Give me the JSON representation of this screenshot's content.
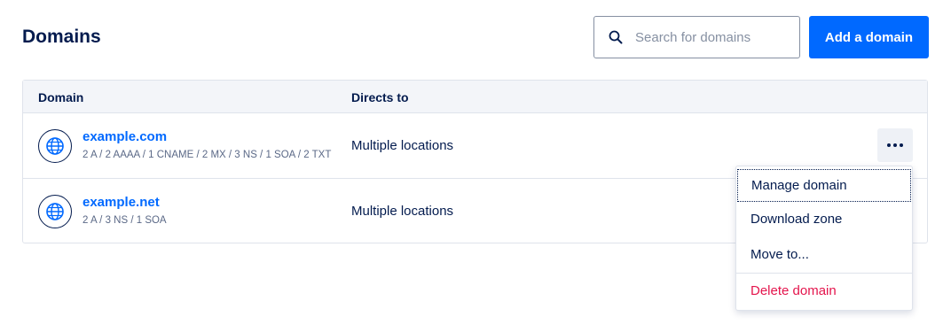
{
  "page": {
    "title": "Domains"
  },
  "search": {
    "placeholder": "Search for domains",
    "value": ""
  },
  "toolbar": {
    "add_label": "Add a domain"
  },
  "table": {
    "columns": [
      "Domain",
      "Directs to"
    ],
    "rows": [
      {
        "domain": "example.com",
        "records": "2 A / 2 AAAA / 1 CNAME / 2 MX / 3 NS / 1 SOA / 2 TXT",
        "directs_to": "Multiple locations"
      },
      {
        "domain": "example.net",
        "records": "2 A / 3 NS / 1 SOA",
        "directs_to": "Multiple locations"
      }
    ]
  },
  "menu": {
    "items": [
      "Manage domain",
      "Download zone",
      "Move to...",
      "Delete domain"
    ]
  },
  "colors": {
    "accent": "#0069ff",
    "text": "#031b4e",
    "danger": "#e4144c",
    "muted": "#5b6987"
  },
  "icons": {
    "search": "search-icon",
    "globe": "globe-icon",
    "more": "more-options-icon"
  }
}
